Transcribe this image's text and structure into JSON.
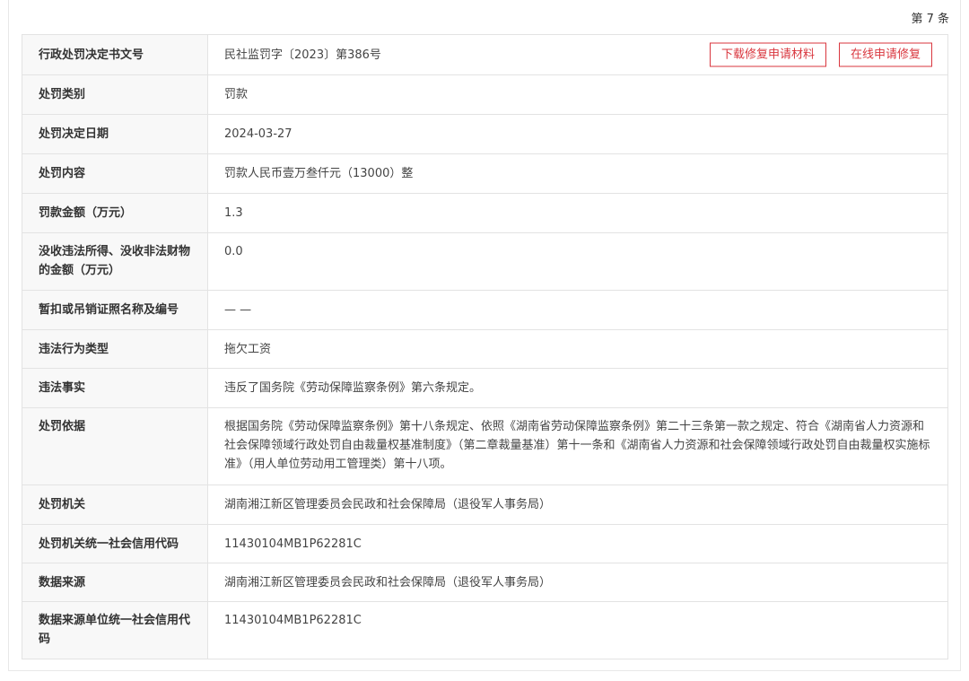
{
  "count_label": "第 7 条",
  "buttons": {
    "download": "下载修复申请材料",
    "online": "在线申请修复"
  },
  "rows": [
    {
      "label": "行政处罚决定书文号",
      "value": "民社监罚字〔2023〕第386号"
    },
    {
      "label": "处罚类别",
      "value": "罚款"
    },
    {
      "label": "处罚决定日期",
      "value": "2024-03-27"
    },
    {
      "label": "处罚内容",
      "value": "罚款人民币壹万叁仟元（13000）整"
    },
    {
      "label": "罚款金额（万元）",
      "value": "1.3"
    },
    {
      "label": "没收违法所得、没收非法财物的金额（万元）",
      "value": "0.0"
    },
    {
      "label": "暂扣或吊销证照名称及编号",
      "value": "— —"
    },
    {
      "label": "违法行为类型",
      "value": "拖欠工资"
    },
    {
      "label": "违法事实",
      "value": "违反了国务院《劳动保障监察条例》第六条规定。"
    },
    {
      "label": "处罚依据",
      "value": "根据国务院《劳动保障监察条例》第十八条规定、依照《湖南省劳动保障监察条例》第二十三条第一款之规定、符合《湖南省人力资源和社会保障领域行政处罚自由裁量权基准制度》（第二章裁量基准）第十一条和《湖南省人力资源和社会保障领域行政处罚自由裁量权实施标准》（用人单位劳动用工管理类）第十八项。"
    },
    {
      "label": "处罚机关",
      "value": "湖南湘江新区管理委员会民政和社会保障局（退役军人事务局）"
    },
    {
      "label": "处罚机关统一社会信用代码",
      "value": "11430104MB1P62281C"
    },
    {
      "label": "数据来源",
      "value": "湖南湘江新区管理委员会民政和社会保障局（退役军人事务局）"
    },
    {
      "label": "数据来源单位统一社会信用代码",
      "value": "11430104MB1P62281C"
    }
  ]
}
